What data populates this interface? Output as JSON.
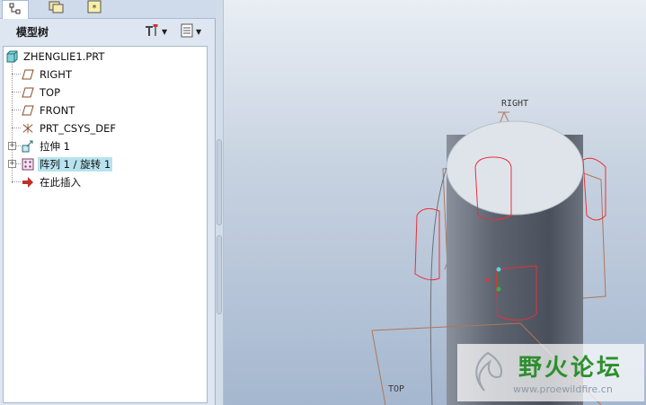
{
  "panel": {
    "tabs": [
      {
        "name": "model-tree-tab",
        "icon": "tree-icon",
        "active": true
      },
      {
        "name": "folder-browser-tab",
        "icon": "folder-icon",
        "active": false
      },
      {
        "name": "favorites-tab",
        "icon": "favorites-icon",
        "active": false
      }
    ],
    "title": "模型树",
    "header_buttons": [
      {
        "name": "tree-tools-button",
        "icon": "tools-icon"
      },
      {
        "name": "tree-settings-button",
        "icon": "settings-list-icon"
      }
    ]
  },
  "tree": {
    "root": {
      "label": "ZHENGLIE1.PRT",
      "icon": "part-icon"
    },
    "items": [
      {
        "label": "RIGHT",
        "icon": "datum-plane-icon",
        "expandable": false,
        "selected": false
      },
      {
        "label": "TOP",
        "icon": "datum-plane-icon",
        "expandable": false,
        "selected": false
      },
      {
        "label": "FRONT",
        "icon": "datum-plane-icon",
        "expandable": false,
        "selected": false
      },
      {
        "label": "PRT_CSYS_DEF",
        "icon": "csys-icon",
        "expandable": false,
        "selected": false
      },
      {
        "label": "拉伸 1",
        "icon": "extrude-icon",
        "expandable": true,
        "selected": false
      },
      {
        "label": "阵列 1 / 旋转 1",
        "icon": "pattern-icon",
        "expandable": true,
        "selected": true
      },
      {
        "label": "在此插入",
        "icon": "insert-arrow-icon",
        "expandable": false,
        "selected": false
      }
    ]
  },
  "viewport": {
    "datum_labels": {
      "right": "RIGHT",
      "top": "TOP"
    },
    "colors": {
      "cylinder_body": "#5d6470",
      "cylinder_top": "#dfe4ea",
      "feature_edges": "#e8303a",
      "datum_planes": "#b0765a"
    }
  },
  "watermark": {
    "title": "野火论坛",
    "url": "www.proewildfire.cn"
  }
}
